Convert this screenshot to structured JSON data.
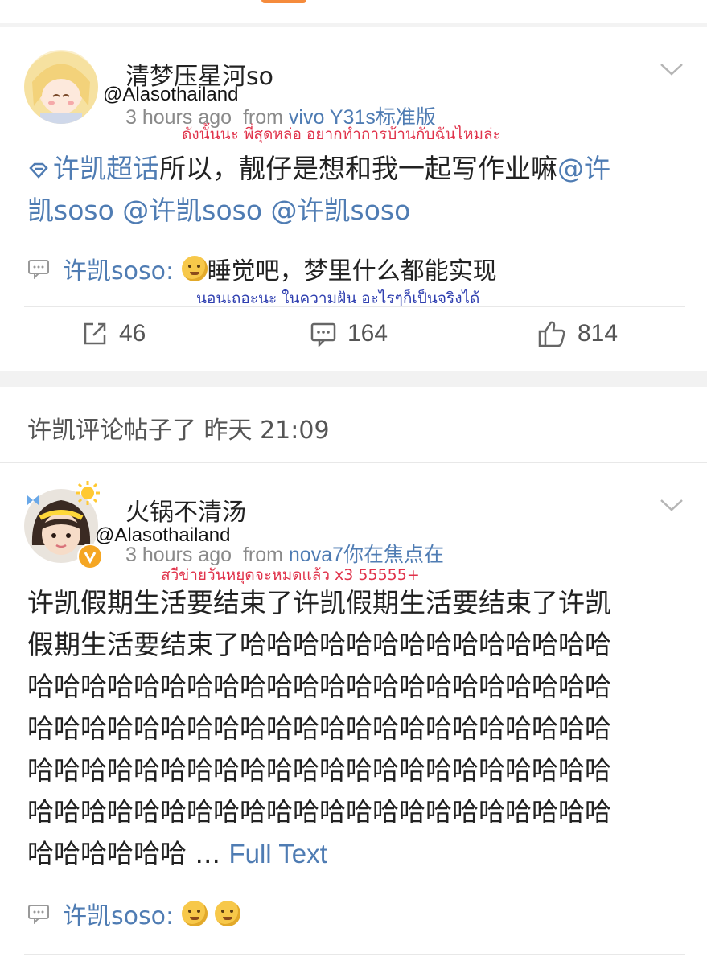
{
  "watermark": "@Alasothailand",
  "post1": {
    "username": "清梦压星河so",
    "time": "3 hours ago",
    "from_label": "from",
    "source": "vivo Y31s标准版",
    "thai_caption": "ดังนั้นนะ พี่สุดหล่อ อยากทำการบ้านกับฉันไหมล่ะ",
    "topic": "许凯超话",
    "text": "所以，靓仔是想和我一起写作业嘛",
    "mentions": [
      "@许",
      "凯soso",
      "@许凯soso",
      "@许凯soso"
    ],
    "comment_user": "许凯soso:",
    "comment_text": "睡觉吧，梦里什么都能实现",
    "comment_thai": "นอนเถอะนะ ในความฝัน อะไรๆก็เป็นจริงได้",
    "reposts": "46",
    "comments": "164",
    "likes": "814"
  },
  "section": {
    "heading": "许凯评论帖子了 昨天 21:09"
  },
  "post2": {
    "username": "火锅不清汤",
    "time": "3 hours ago",
    "from_label": "from",
    "source": "nova7你在焦点在",
    "thai_caption": "สวีข่ายวันหยุดจะหมดแล้ว x3 55555+",
    "lines": [
      "许凯假期生活要结束了许凯假期生活要结束了许凯",
      "假期生活要结束了哈哈哈哈哈哈哈哈哈哈哈哈哈哈",
      "哈哈哈哈哈哈哈哈哈哈哈哈哈哈哈哈哈哈哈哈哈哈",
      "哈哈哈哈哈哈哈哈哈哈哈哈哈哈哈哈哈哈哈哈哈哈",
      "哈哈哈哈哈哈哈哈哈哈哈哈哈哈哈哈哈哈哈哈哈哈",
      "哈哈哈哈哈哈哈哈哈哈哈哈哈哈哈哈哈哈哈哈哈哈"
    ],
    "last_line": "哈哈哈哈哈哈 ...",
    "full_text": "Full Text",
    "comment_user": "许凯soso:"
  },
  "colors": {
    "link": "#4f7cb3",
    "thai_red": "#e0324a",
    "thai_blue": "#2f3fb0",
    "accent_orange": "#f58b3c"
  },
  "icons": [
    "chevron-down-icon",
    "supertopic-icon",
    "comment-bubble-icon",
    "repost-icon",
    "like-icon",
    "verified-badge-icon",
    "emoji-icon"
  ]
}
